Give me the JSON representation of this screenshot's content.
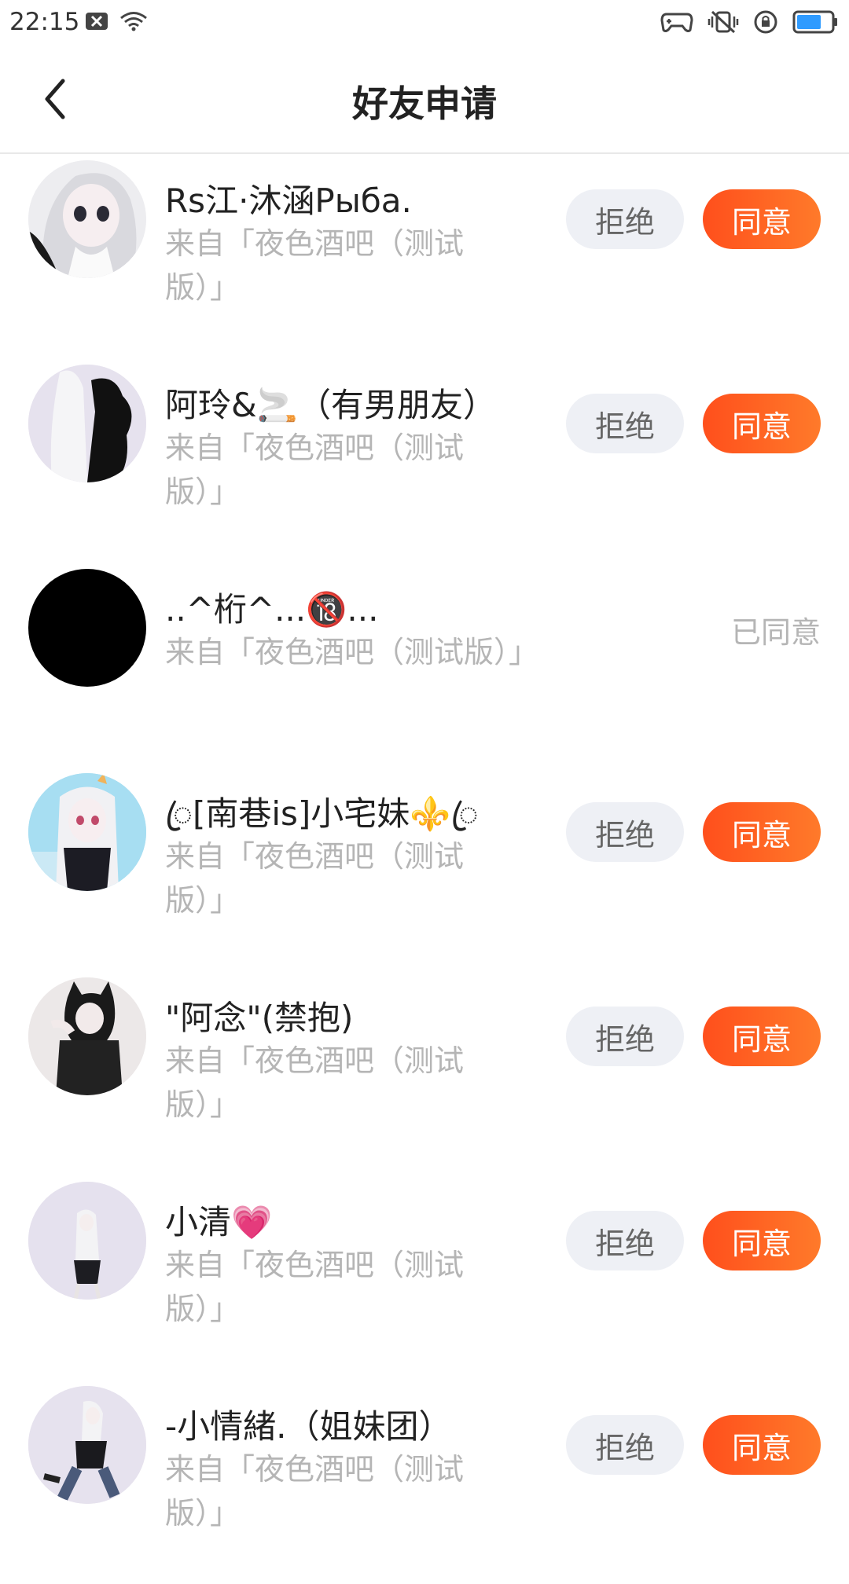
{
  "status_bar": {
    "time": "22:15"
  },
  "header": {
    "title": "好友申请"
  },
  "colors": {
    "accent": "#ff5a1f",
    "reject_bg": "#eef0f5"
  },
  "requests": [
    {
      "name": "Rs江·沐涵Рыба.",
      "source": "来自「夜色酒吧（测试版）」",
      "reject_label": "拒绝",
      "accept_label": "同意"
    },
    {
      "name": "阿玲&🚬（有男朋友）",
      "source": "来自「夜色酒吧（测试版）」",
      "reject_label": "拒绝",
      "accept_label": "同意"
    },
    {
      "name": "..^桁^...🔞...",
      "source": "来自「夜色酒吧（测试版）」",
      "status": "已同意"
    },
    {
      "name": "ꦿ[南巷is]小宅妹⚜️ꦿ",
      "source": "来自「夜色酒吧（测试版）」",
      "reject_label": "拒绝",
      "accept_label": "同意"
    },
    {
      "name": "\"阿念\"(禁抱)",
      "source": "来自「夜色酒吧（测试版）」",
      "reject_label": "拒绝",
      "accept_label": "同意"
    },
    {
      "name": "小清💗",
      "source": "来自「夜色酒吧（测试版）」",
      "reject_label": "拒绝",
      "accept_label": "同意"
    },
    {
      "name": "-小情緒.（姐妹团）",
      "source": "来自「夜色酒吧（测试版）」",
      "reject_label": "拒绝",
      "accept_label": "同意"
    }
  ]
}
